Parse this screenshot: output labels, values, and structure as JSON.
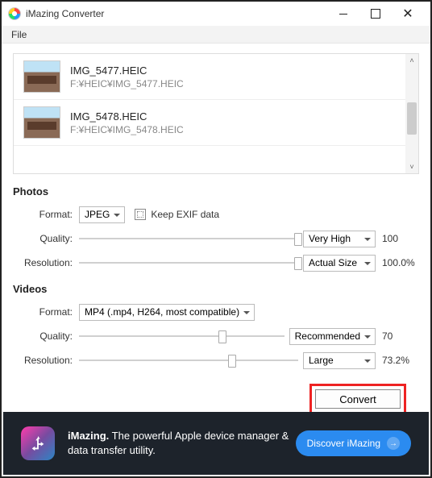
{
  "window": {
    "title": "iMazing Converter"
  },
  "menubar": {
    "file": "File"
  },
  "files": [
    {
      "name": "IMG_5477.HEIC",
      "path": "F:¥HEIC¥IMG_5477.HEIC"
    },
    {
      "name": "IMG_5478.HEIC",
      "path": "F:¥HEIC¥IMG_5478.HEIC"
    }
  ],
  "photos": {
    "section": "Photos",
    "format_label": "Format:",
    "format_value": "JPEG",
    "keep_exif_label": "Keep EXIF data",
    "keep_exif_checked": false,
    "quality_label": "Quality:",
    "quality_dropdown": "Very High",
    "quality_value": "100",
    "quality_slider_pct": 100,
    "resolution_label": "Resolution:",
    "resolution_dropdown": "Actual Size",
    "resolution_value": "100.0%",
    "resolution_slider_pct": 100
  },
  "videos": {
    "section": "Videos",
    "format_label": "Format:",
    "format_value": "MP4 (.mp4, H264, most compatible)",
    "quality_label": "Quality:",
    "quality_dropdown": "Recommended",
    "quality_value": "70",
    "quality_slider_pct": 70,
    "resolution_label": "Resolution:",
    "resolution_dropdown": "Large",
    "resolution_value": "73.2%",
    "resolution_slider_pct": 70
  },
  "actions": {
    "convert": "Convert"
  },
  "footer": {
    "brand": "iMazing.",
    "tagline": " The powerful Apple device manager & data transfer utility.",
    "cta": "Discover iMazing"
  }
}
